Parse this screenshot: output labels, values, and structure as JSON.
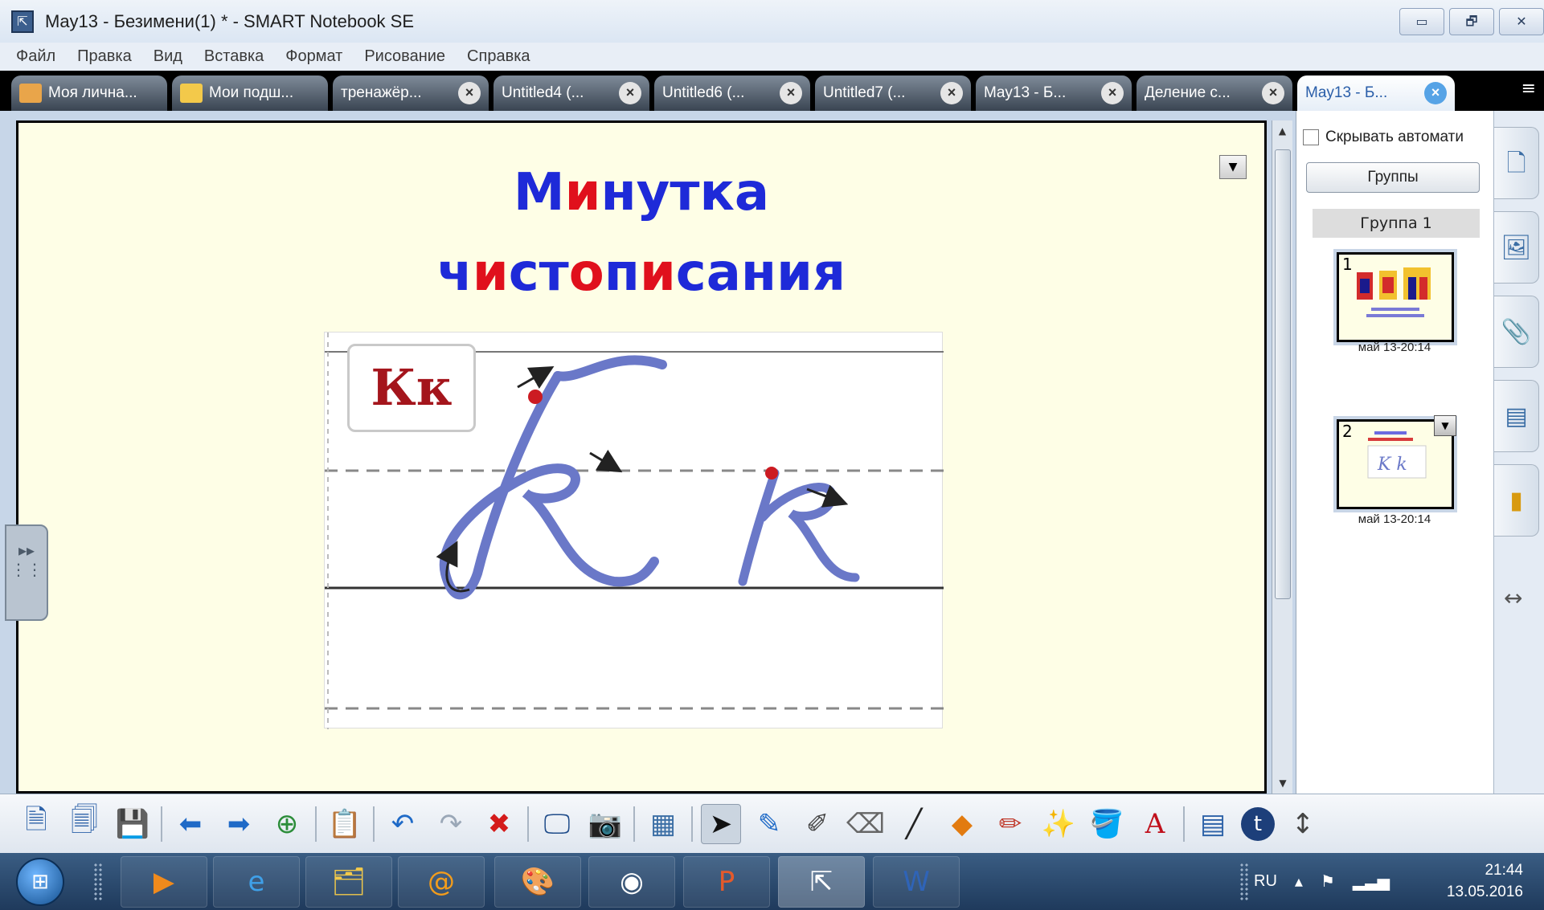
{
  "window": {
    "title": "May13 - Безимени(1) * - SMART Notebook SE",
    "controls": [
      "▭",
      "🗗",
      "✕"
    ]
  },
  "menu": [
    "Файл",
    "Правка",
    "Вид",
    "Вставка",
    "Формат",
    "Рисование",
    "Справка"
  ],
  "tabs": [
    {
      "label": "Моя лична...",
      "icon": "home-icon",
      "closable": false
    },
    {
      "label": "Мои подш...",
      "icon": "folder-icon",
      "closable": false
    },
    {
      "label": "тренажёр...",
      "closable": true
    },
    {
      "label": "Untitled4 (...",
      "closable": true
    },
    {
      "label": "Untitled6 (...",
      "closable": true
    },
    {
      "label": "Untitled7 (...",
      "closable": true
    },
    {
      "label": "May13 - Б...",
      "closable": true
    },
    {
      "label": "Деление с...",
      "closable": true
    },
    {
      "label": "May13 - Б...",
      "closable": true,
      "active": true
    }
  ],
  "page": {
    "heading_line1": [
      {
        "text": "М",
        "color": "blue"
      },
      {
        "text": "и",
        "color": "red"
      },
      {
        "text": "нутка",
        "color": "blue"
      }
    ],
    "heading_line2": [
      {
        "text": "ч",
        "color": "blue"
      },
      {
        "text": "и",
        "color": "red"
      },
      {
        "text": "ст",
        "color": "blue"
      },
      {
        "text": "о",
        "color": "red"
      },
      {
        "text": "п",
        "color": "blue"
      },
      {
        "text": "и",
        "color": "red"
      },
      {
        "text": "сания",
        "color": "blue"
      }
    ],
    "sample_letters": "Кк",
    "colors": {
      "blue": "#1e2ad8",
      "red": "#e0101c",
      "background": "#fefee6"
    }
  },
  "sidebar": {
    "autohide_label": "Скрывать автомати",
    "groups_button": "Группы",
    "group_header": "Группа 1",
    "pages": [
      {
        "number": "1",
        "caption": "май 13-20:14"
      },
      {
        "number": "2",
        "caption": "май 13-20:14"
      }
    ]
  },
  "taskbar": {
    "language": "RU",
    "time": "21:44",
    "date": "13.05.2016"
  }
}
